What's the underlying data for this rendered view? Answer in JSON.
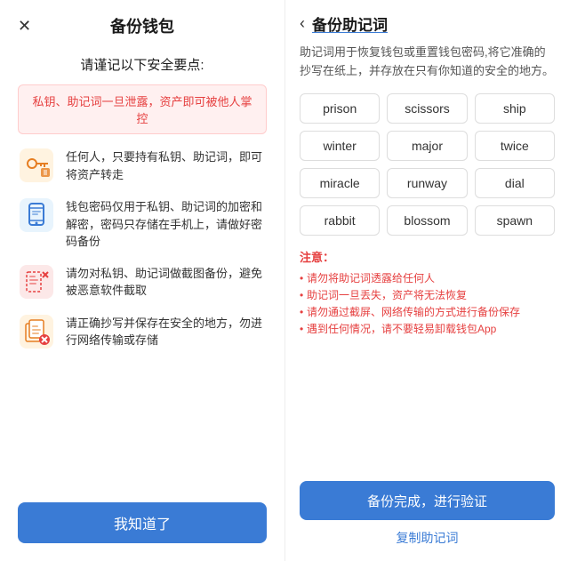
{
  "leftPanel": {
    "closeIcon": "✕",
    "title": "备份钱包",
    "safetyTitle": "请谨记以下安全要点:",
    "warningText": "私钥、助记词一旦泄露，资产即可被他人掌控",
    "items": [
      {
        "id": "key",
        "text": "任何人，只要持有私钥、助记词，即可将资产转走"
      },
      {
        "id": "phone",
        "text": "钱包密码仅用于私钥、助记词的加密和解密，密码只存储在手机上，请做好密码备份"
      },
      {
        "id": "screenshot",
        "text": "请勿对私钥、助记词做截图备份，避免被恶意软件截取"
      },
      {
        "id": "copy",
        "text": "请正确抄写并保存在安全的地方，勿进行网络传输或存储"
      }
    ],
    "confirmButton": "我知道了"
  },
  "rightPanel": {
    "backIcon": "‹",
    "title": "备份助记词",
    "description": "助记词用于恢复钱包或重置钱包密码,将它准确的抄写在纸上，并存放在只有你知道的安全的地方。",
    "words": [
      "prison",
      "scissors",
      "ship",
      "winter",
      "major",
      "twice",
      "miracle",
      "runway",
      "dial",
      "rabbit",
      "blossom",
      "spawn"
    ],
    "notesTitle": "注意：",
    "notes": [
      "请勿将助记词透露给任何人",
      "助记词一旦丢失，资产将无法恢复",
      "请勿通过截屏、网络传输的方式进行备份保存",
      "遇到任何情况，请不要轻易卸载钱包App"
    ],
    "backupButton": "备份完成，进行验证",
    "copyButton": "复制助记词"
  }
}
